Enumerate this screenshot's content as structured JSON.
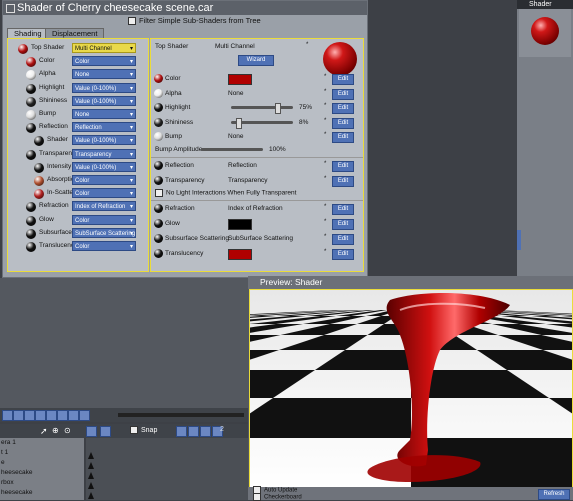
{
  "window": {
    "title": "Shader of Cherry cheesecake scene.car"
  },
  "filter": {
    "label": "Filter Simple Sub-Shaders from Tree"
  },
  "tabs": [
    {
      "label": "Shading"
    },
    {
      "label": "Displacement"
    }
  ],
  "tree": [
    {
      "label": "Top Shader",
      "value": "Multi Channel",
      "ball": "#b01010",
      "indent": 0,
      "selected": true
    },
    {
      "label": "Color",
      "value": "Color",
      "ball": "#b01010",
      "indent": 1
    },
    {
      "label": "Alpha",
      "value": "None",
      "ball": "#eeeeee",
      "indent": 1
    },
    {
      "label": "Highlight",
      "value": "Value (0-100%)",
      "ball": "#111111",
      "indent": 1
    },
    {
      "label": "Shininess",
      "value": "Value (0-100%)",
      "ball": "#222222",
      "indent": 1
    },
    {
      "label": "Bump",
      "value": "None",
      "ball": "#dddddd",
      "indent": 1
    },
    {
      "label": "Reflection",
      "value": "Reflection",
      "ball": "#111111",
      "indent": 1
    },
    {
      "label": "Shader",
      "value": "Value (0-100%)",
      "ball": "#111111",
      "indent": 2
    },
    {
      "label": "Transparency",
      "value": "Transparency",
      "ball": "#111111",
      "indent": 1
    },
    {
      "label": "Intensity",
      "value": "Value (0-100%)",
      "ball": "#111111",
      "indent": 2
    },
    {
      "label": "Absorption",
      "value": "Color",
      "ball": "#b05030",
      "indent": 2
    },
    {
      "label": "In-Scattering",
      "value": "Color",
      "ball": "#b02020",
      "indent": 2
    },
    {
      "label": "Refraction",
      "value": "Index of Refraction",
      "ball": "#111111",
      "indent": 1
    },
    {
      "label": "Glow",
      "value": "Color",
      "ball": "#111111",
      "indent": 1
    },
    {
      "label": "Subsurface Sc",
      "value": "SubSurface Scattering",
      "ball": "#111111",
      "indent": 1
    },
    {
      "label": "Translucency",
      "value": "Color",
      "ball": "#111111",
      "indent": 1
    }
  ],
  "detail": {
    "top_label": "Top Shader",
    "top_value": "Multi Channel",
    "wizard": "Wizard",
    "edit": "Edit",
    "rows": [
      {
        "label": "Color",
        "kind": "swatch",
        "swatch": "#b00000",
        "ball": "#b01010"
      },
      {
        "label": "Alpha",
        "kind": "text",
        "value": "None",
        "ball": "#eeeeee"
      },
      {
        "label": "Highlight",
        "kind": "slider",
        "value": "75%",
        "fraction": 0.75,
        "ball": "#111111"
      },
      {
        "label": "Shininess",
        "kind": "slider",
        "value": "8%",
        "fraction": 0.08,
        "ball": "#222222"
      },
      {
        "label": "Bump",
        "kind": "text",
        "value": "None",
        "ball": "#dddddd"
      }
    ],
    "bump_amplitude": {
      "label": "Bump Amplitude",
      "value": "100%",
      "fraction": 1.0
    },
    "rows2": [
      {
        "label": "Reflection",
        "kind": "text",
        "value": "Reflection",
        "ball": "#111111"
      },
      {
        "label": "Transparency",
        "kind": "text",
        "value": "Transparency",
        "ball": "#111111"
      }
    ],
    "no_light": "No Light Interactions When Fully Transparent",
    "rows3": [
      {
        "label": "Refraction",
        "kind": "text",
        "value": "Index of Refraction",
        "ball": "#111111"
      },
      {
        "label": "Glow",
        "kind": "swatch",
        "swatch": "#000000",
        "ball": "#111111"
      },
      {
        "label": "Subsurface Scattering",
        "kind": "text",
        "value": "SubSurface Scattering",
        "ball": "#111111"
      },
      {
        "label": "Translucency",
        "kind": "swatch",
        "swatch": "#b00000",
        "ball": "#111111"
      }
    ]
  },
  "right_panel": {
    "title": "Shader"
  },
  "preview": {
    "title": "Preview: Shader",
    "auto_update": "Auto Update",
    "checkerboard": "Checkerboard",
    "refresh": "Refresh"
  },
  "timeline": {
    "snap": "Snap",
    "tick_2": "2",
    "items": [
      "era 1",
      "t 1",
      "e",
      "heesecake",
      "rbox",
      "heesecake"
    ]
  }
}
